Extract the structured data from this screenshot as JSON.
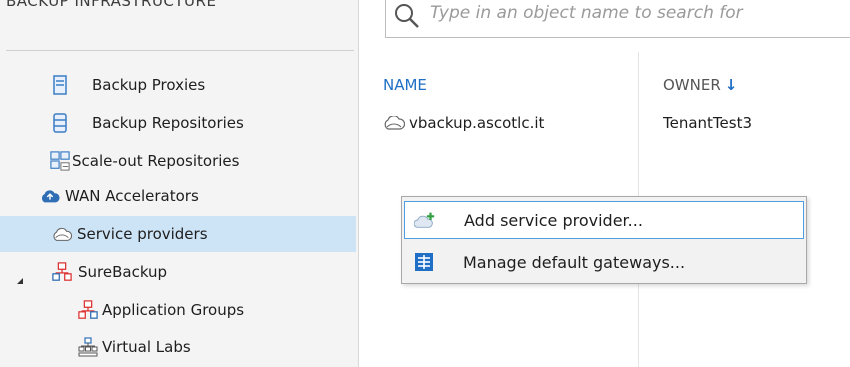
{
  "nav": {
    "section_title": "BACKUP INFRASTRUCTURE",
    "items": [
      {
        "label": "Backup Proxies",
        "icon": "server-icon"
      },
      {
        "label": "Backup Repositories",
        "icon": "database-icon"
      },
      {
        "label": "Scale-out Repositories",
        "icon": "scaleout-repository-icon"
      },
      {
        "label": "WAN Accelerators",
        "icon": "cloud-accelerator-icon"
      },
      {
        "label": "Service providers",
        "icon": "cloud-icon",
        "selected": true
      },
      {
        "label": "SureBackup",
        "icon": "surebackup-icon",
        "expanded": true
      },
      {
        "label": "Application Groups",
        "icon": "app-group-icon"
      },
      {
        "label": "Virtual Labs",
        "icon": "virtual-lab-icon"
      }
    ]
  },
  "search": {
    "placeholder": "Type in an object name to search for"
  },
  "grid": {
    "columns": [
      "NAME",
      "OWNER"
    ],
    "sort_column": "OWNER",
    "sort_indicator": "↓",
    "rows": [
      {
        "name": "vbackup.ascotlc.it",
        "owner": "TenantTest3"
      }
    ]
  },
  "context_menu": {
    "items": [
      {
        "label": "Add service provider...",
        "icon": "add-cloud-icon"
      },
      {
        "label": "Manage default gateways...",
        "icon": "gateway-icon"
      }
    ]
  },
  "colors": {
    "accent": "#1f6fc6",
    "selection": "#cde4f7",
    "menu_border": "#4f9ee0"
  }
}
